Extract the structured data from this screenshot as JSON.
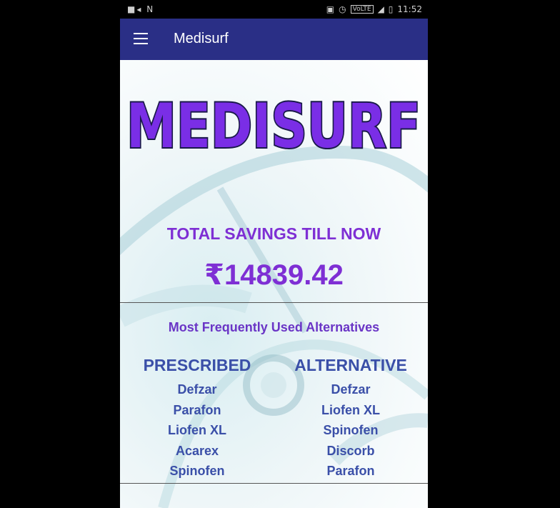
{
  "status_bar": {
    "time": "11:52",
    "network_label": "VoLTE"
  },
  "app_bar": {
    "title": "Medisurf"
  },
  "logo": {
    "text": "MEDISURF"
  },
  "savings": {
    "label": "TOTAL SAVINGS TILL NOW",
    "amount": "₹14839.42"
  },
  "alternatives": {
    "title": "Most Frequently Used Alternatives",
    "prescribed_header": "PRESCRIBED",
    "alternative_header": "ALTERNATIVE",
    "prescribed": [
      "Defzar",
      "Parafon",
      "Liofen XL",
      "Acarex",
      "Spinofen"
    ],
    "alternative": [
      "Defzar",
      "Liofen XL",
      "Spinofen",
      "Discorb",
      "Parafon"
    ]
  },
  "colors": {
    "app_bar": "#2a2f86",
    "accent_purple": "#7e2fd4",
    "list_blue": "#3a4fa8"
  }
}
